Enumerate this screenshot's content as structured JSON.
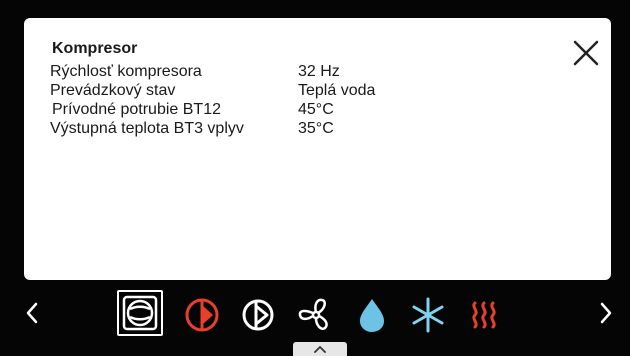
{
  "panel": {
    "title": "Kompresor",
    "rows": [
      {
        "label": "Rýchlosť kompresora",
        "value": "32 Hz"
      },
      {
        "label": "Prevádzkový stav",
        "value": "Teplá voda"
      },
      {
        "label": "Prívodné potrubie BT12",
        "value": "45°C"
      },
      {
        "label": "Výstupná teplota BT3 vplyv",
        "value": "35°C"
      }
    ],
    "close_icon": "close-icon"
  },
  "bottom_nav": {
    "prev_icon": "chevron-left-icon",
    "next_icon": "chevron-right-icon",
    "items": [
      {
        "icon": "compressor-icon",
        "selected": true,
        "color": "#ffffff"
      },
      {
        "icon": "pump-red-icon",
        "color": "#e8402a"
      },
      {
        "icon": "pump-white-icon",
        "color": "#ffffff"
      },
      {
        "icon": "fan-icon",
        "color": "#ffffff"
      },
      {
        "icon": "water-drop-icon",
        "color": "#6cc3e6"
      },
      {
        "icon": "snowflake-icon",
        "color": "#7fd3ef"
      },
      {
        "icon": "heating-icon",
        "color": "#e8402a"
      }
    ],
    "expand_icon": "chevron-up-icon"
  }
}
